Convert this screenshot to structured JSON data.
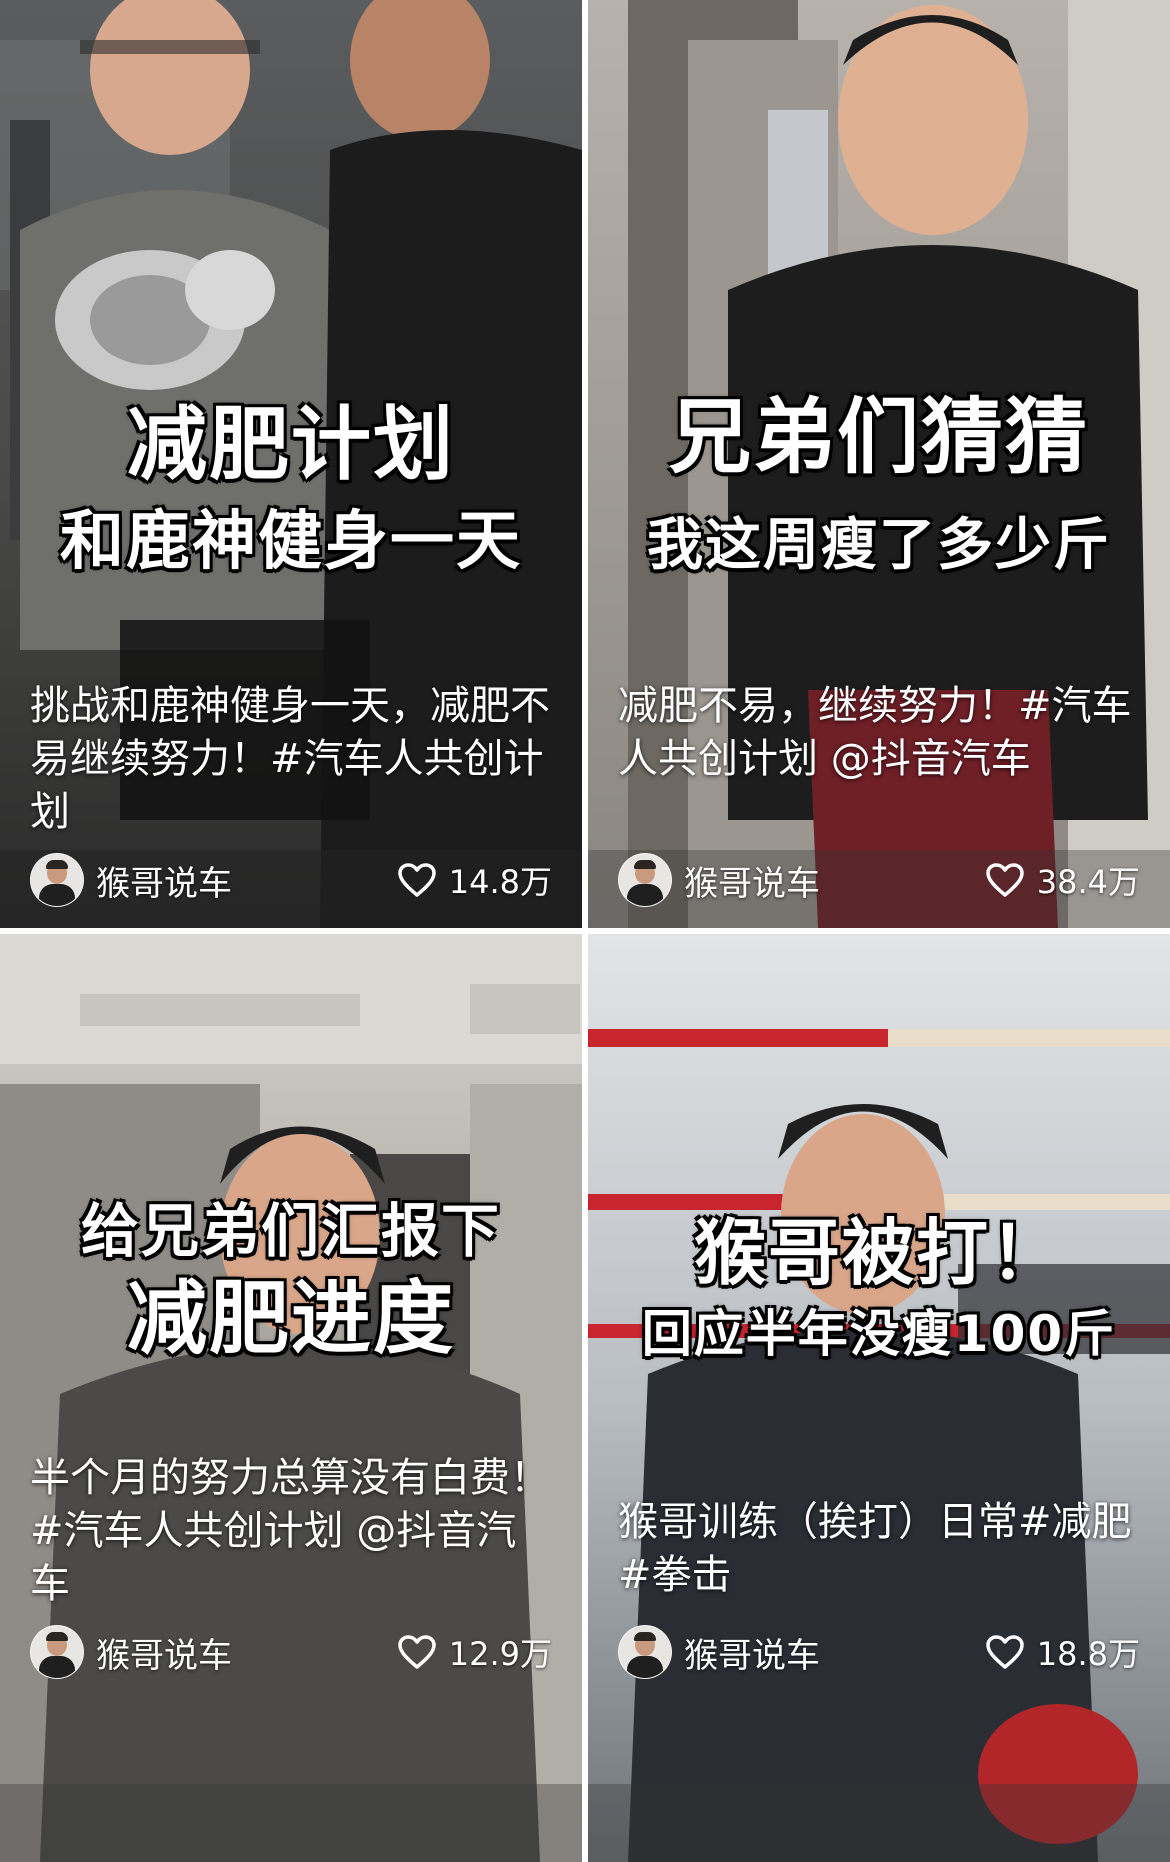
{
  "feed": {
    "cards": [
      {
        "title_lines": [
          "减肥计划",
          "和鹿神健身一天"
        ],
        "caption": "挑战和鹿神健身一天，减肥不易继续努力！#汽车人共创计划",
        "author": "猴哥说车",
        "likes": "14.8万",
        "bg_color": "#6b6a66"
      },
      {
        "title_lines": [
          "兄弟们猜猜",
          "我这周瘦了多少斤"
        ],
        "caption": "减肥不易，继续努力！#汽车人共创计划 @抖音汽车",
        "author": "猴哥说车",
        "likes": "38.4万",
        "bg_color": "#8f8b86"
      },
      {
        "title_lines": [
          "给兄弟们汇报下",
          "减肥进度"
        ],
        "caption": "半个月的努力总算没有白费！#汽车人共创计划 @抖音汽车",
        "author": "猴哥说车",
        "likes": "12.9万",
        "bg_color": "#9b9791"
      },
      {
        "title_lines": [
          "猴哥被打！",
          "回应半年没瘦100斤"
        ],
        "caption": "猴哥训练（挨打）日常#减肥 #拳击",
        "author": "猴哥说车",
        "likes": "18.8万",
        "bg_color": "#bfc4c8"
      }
    ]
  },
  "icons": {
    "like": "heart-outline-icon",
    "avatar": "avatar-icon"
  },
  "colors": {
    "text": "#ffffff",
    "divider": "#ffffff"
  }
}
